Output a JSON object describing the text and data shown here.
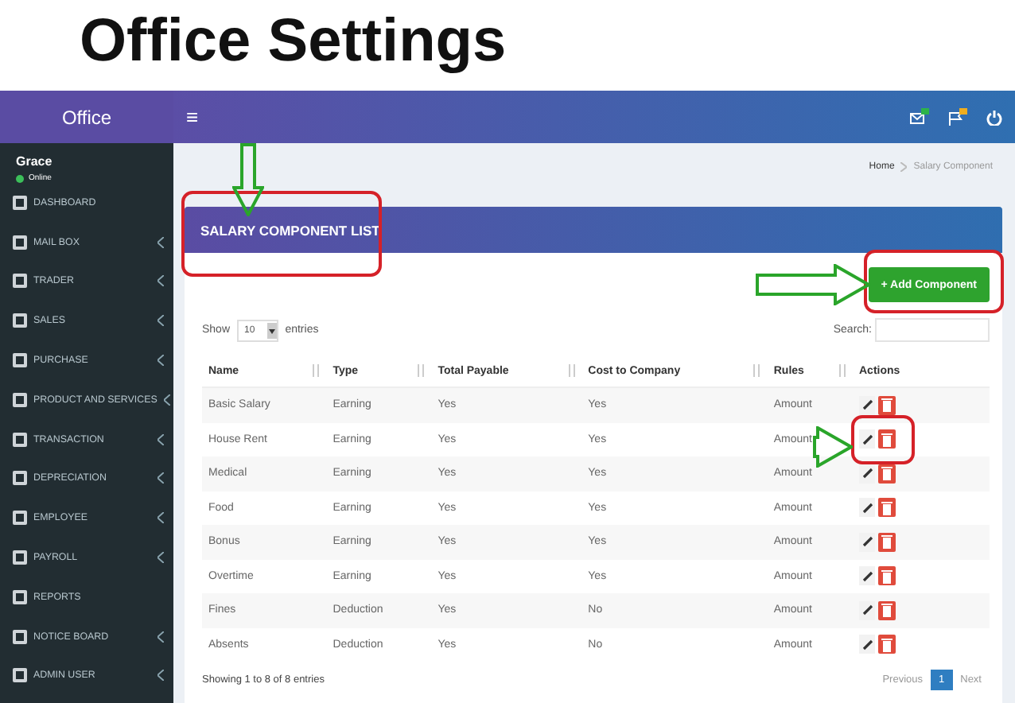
{
  "slide_title": "Office Settings",
  "sidebar": {
    "brand": "Office",
    "user": "Grace",
    "status": "Online",
    "items": [
      {
        "label": "DASHBOARD",
        "caret": false
      },
      {
        "label": "MAIL BOX",
        "caret": true
      },
      {
        "label": "TRADER",
        "caret": true
      },
      {
        "label": "SALES",
        "caret": true
      },
      {
        "label": "PURCHASE",
        "caret": true
      },
      {
        "label": "PRODUCT AND SERVICES",
        "caret": true
      },
      {
        "label": "TRANSACTION",
        "caret": true
      },
      {
        "label": "DEPRECIATION",
        "caret": true
      },
      {
        "label": "EMPLOYEE",
        "caret": true
      },
      {
        "label": "PAYROLL",
        "caret": true
      },
      {
        "label": "REPORTS",
        "caret": false
      },
      {
        "label": "NOTICE BOARD",
        "caret": true
      },
      {
        "label": "ADMIN USER",
        "caret": true
      }
    ]
  },
  "topbar": {
    "menu_glyph": "≡"
  },
  "breadcrumb": [
    "Home",
    "Salary Component"
  ],
  "box": {
    "title": "SALARY COMPONENT LIST",
    "add_button": "+ Add Component",
    "show_label": "Show",
    "length": "10",
    "entries_label": "entries",
    "search_label": "Search:"
  },
  "table": {
    "columns": [
      "Name",
      "Type",
      "Total Payable",
      "Cost to Company",
      "Rules",
      "Actions"
    ],
    "rows": [
      [
        "Basic Salary",
        "Earning",
        "Yes",
        "Yes",
        "Amount"
      ],
      [
        "House Rent",
        "Earning",
        "Yes",
        "Yes",
        "Amount"
      ],
      [
        "Medical",
        "Earning",
        "Yes",
        "Yes",
        "Amount"
      ],
      [
        "Food",
        "Earning",
        "Yes",
        "Yes",
        "Amount"
      ],
      [
        "Bonus",
        "Earning",
        "Yes",
        "Yes",
        "Amount"
      ],
      [
        "Overtime",
        "Earning",
        "Yes",
        "Yes",
        "Amount"
      ],
      [
        "Fines",
        "Deduction",
        "Yes",
        "No",
        "Amount"
      ],
      [
        "Absents",
        "Deduction",
        "Yes",
        "No",
        "Amount"
      ]
    ]
  },
  "info": "Showing 1 to 8 of 8 entries",
  "pagination": [
    {
      "label": "Previous",
      "selected": false
    },
    {
      "label": "1",
      "selected": true
    },
    {
      "label": "Next",
      "selected": false
    }
  ]
}
